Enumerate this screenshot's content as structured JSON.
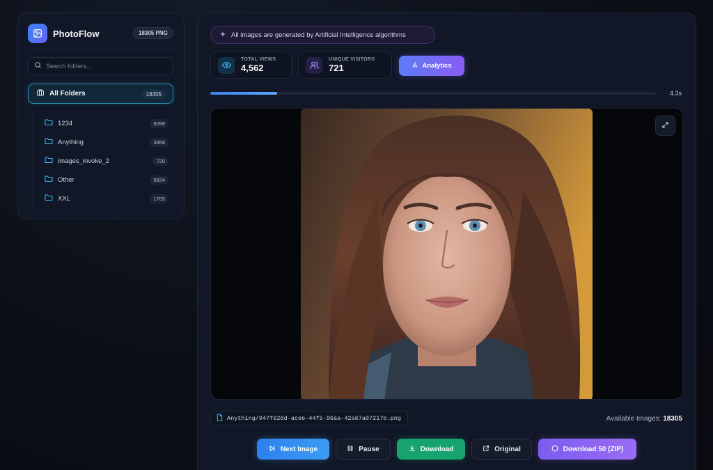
{
  "sidebar": {
    "brand_name": "PhotoFlow",
    "brand_badge": "18305 PNG",
    "search_placeholder": "Search folders...",
    "all_folders": {
      "label": "All Folders",
      "count": "18305"
    },
    "folders": [
      {
        "label": "1234",
        "count": "6098"
      },
      {
        "label": "Anything",
        "count": "3958"
      },
      {
        "label": "images_invoke_2",
        "count": "720"
      },
      {
        "label": "Other",
        "count": "5824"
      },
      {
        "label": "XXL",
        "count": "1705"
      }
    ]
  },
  "main": {
    "ai_notice": "All images are generated by Artificial Intelligence algorithms",
    "stats": [
      {
        "label": "TOTAL VIEWS",
        "value": "4,562",
        "icon": "eye-icon"
      },
      {
        "label": "UNIQUE VISITORS",
        "value": "721",
        "icon": "users-icon"
      }
    ],
    "analytics_label": "Analytics",
    "slideshow": {
      "progress": 0.15,
      "time_label": "4.3s"
    },
    "file_path": "Anything/947f628d-acee-44f5-96aa-42a67a07217b.png",
    "available_label": "Available Images:",
    "available_count": "18305",
    "actions": {
      "next": "Next Image",
      "pause": "Pause",
      "download": "Download",
      "original": "Original",
      "zip": "Download 50 (ZIP)"
    }
  },
  "colors": {
    "accent_blue": "#3b82f6",
    "accent_purple": "#8b5cf6",
    "success_green": "#16a36f",
    "selected_border": "#2a91b8"
  }
}
